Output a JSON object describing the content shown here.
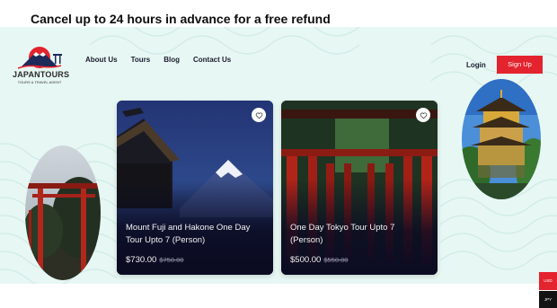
{
  "banner": {
    "text": "Cancel up to 24 hours in advance for a free refund"
  },
  "header": {
    "logo": {
      "wordmark": "JAPANTOURS",
      "tagline": "TOURS & TRAVEL AGENT",
      "icon": "mount-fuji-icon"
    },
    "nav": [
      {
        "label": "About Us"
      },
      {
        "label": "Tours"
      },
      {
        "label": "Blog"
      },
      {
        "label": "Contact Us"
      }
    ],
    "login_label": "Login",
    "signup_label": "Sign Up"
  },
  "cards": [
    {
      "title": "Mount Fuji and Hakone One Day Tour Upto 7 (Person)",
      "price": "$730.00",
      "old_price": "$750.00",
      "favorite_icon": "heart-icon"
    },
    {
      "title": "One Day Tokyo Tour Upto 7 (Person)",
      "price": "$500.00",
      "old_price": "$550.00",
      "favorite_icon": "heart-icon"
    }
  ],
  "side_tabs": {
    "currency": "USD",
    "language": "JPY"
  },
  "colors": {
    "accent": "#e3232d",
    "hero_bg": "#e7f7f3",
    "card_bg": "#0b0b22"
  }
}
